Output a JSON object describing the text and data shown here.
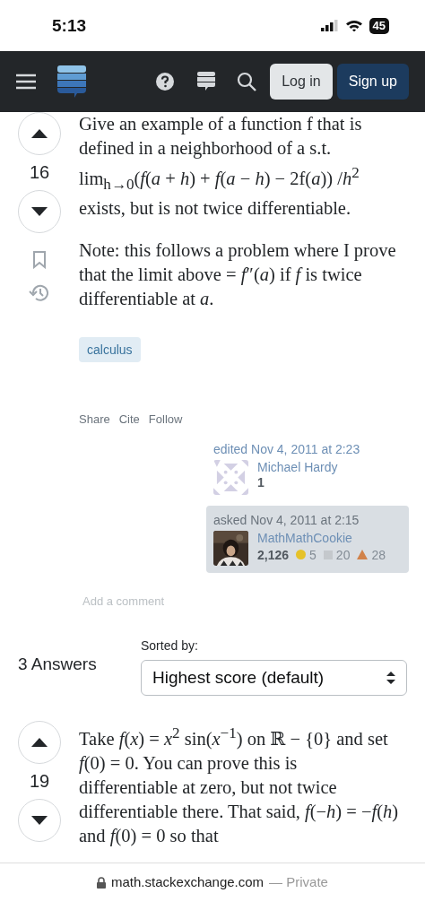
{
  "status_bar": {
    "time": "5:13",
    "battery": "45"
  },
  "header": {
    "buttons": [
      {
        "label": "Log in",
        "kind": "secondary"
      },
      {
        "label": "Sign up",
        "kind": "primary"
      }
    ]
  },
  "question": {
    "score": "16",
    "paragraphs": [
      "Give an example of a function f that is defined in a neighborhood of a s.t. lim$_{h→0}$(*f*(*a* + *h*) + *f*(*a* − *h*) − 2f(*a*)) /*h*$^{2}$ exists, but is not twice differentiable.",
      "Note: this follows a problem where I prove that the limit above = *f*″(*a*) if *f* is twice differentiable at *a*."
    ],
    "tags": [
      "calculus"
    ],
    "actions": [
      "Share",
      "Cite",
      "Follow"
    ],
    "edited": {
      "label": "edited Nov 4, 2011 at 2:23",
      "user": "Michael Hardy",
      "reputation": "1"
    },
    "asked": {
      "label": "asked Nov 4, 2011 at 2:15",
      "user": "MathMathCookie",
      "reputation": "2,126",
      "badges": [
        {
          "kind": "circle",
          "color": "#e6c229",
          "count": "5"
        },
        {
          "kind": "square",
          "color": "#c4c8cc",
          "count": "20"
        },
        {
          "kind": "triangle",
          "color": "#d1824a",
          "count": "28"
        }
      ]
    },
    "add_comment": "Add a comment"
  },
  "answers_header": {
    "count": "3 Answers",
    "sort_label": "Sorted by:",
    "sort_value": "Highest score (default)"
  },
  "answers": [
    {
      "score": "19",
      "paragraphs": [
        "Take *f*(*x*) = *x*$^{2}$ sin(*x*$^{−1}$) on ℝ − {0} and set *f*(0) = 0. You can prove this is differentiable at zero, but not twice differentiable there. That said, *f*(−*h*) = −*f*(*h*) and *f*(0) = 0 so that"
      ]
    }
  ],
  "browser_bar": {
    "url": "math.stackexchange.com",
    "mode": "— Private"
  }
}
